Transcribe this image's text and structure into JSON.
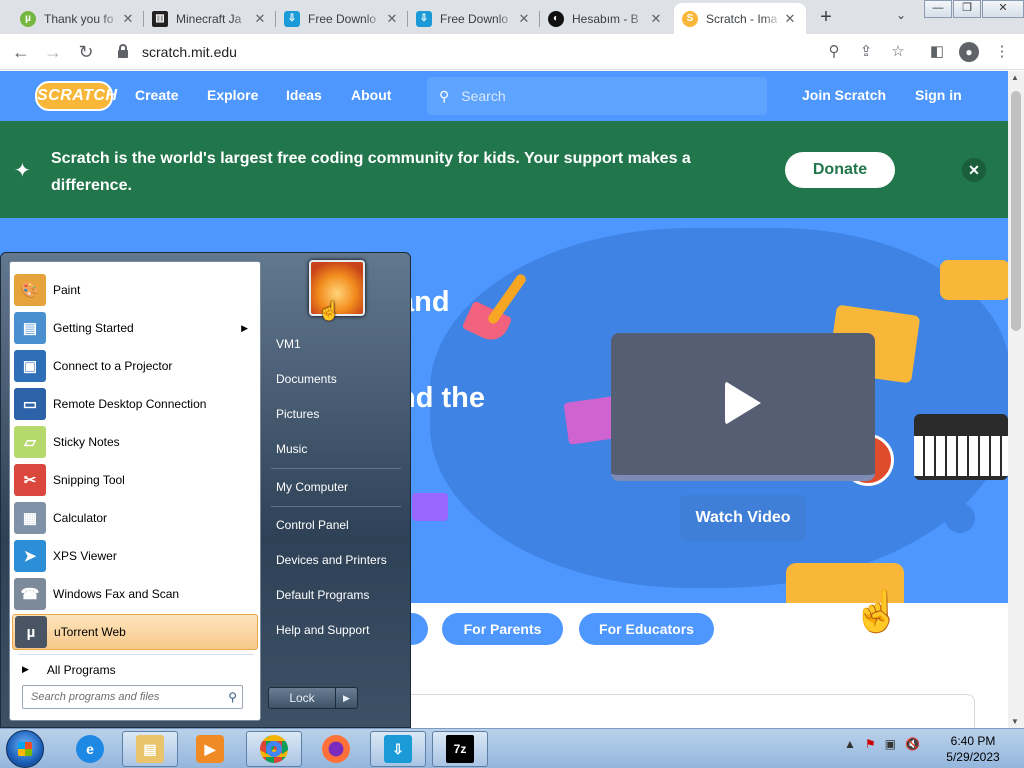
{
  "browser": {
    "tabs": [
      {
        "title": "Thank you fo",
        "favicon": "utorrent-icon",
        "color": "#76b83f"
      },
      {
        "title": "Minecraft Ja",
        "favicon": "museum-icon",
        "color": "#222222"
      },
      {
        "title": "Free Downlo",
        "favicon": "download-icon",
        "color": "#1a9bd7"
      },
      {
        "title": "Free Downlo",
        "favicon": "download-icon",
        "color": "#1a9bd7"
      },
      {
        "title": "Hesabım - B",
        "favicon": "circle-icon",
        "color": "#111111"
      },
      {
        "title": "Scratch - Ima",
        "favicon": "scratch-icon",
        "color": "#f9b739"
      }
    ],
    "new_tab": "+",
    "url": "scratch.mit.edu"
  },
  "scratch": {
    "logo": "SCRATCH",
    "nav": [
      "Create",
      "Explore",
      "Ideas",
      "About"
    ],
    "search_placeholder": "Search",
    "join": "Join Scratch",
    "signin": "Sign in",
    "banner_text": "Scratch is the world's largest free coding community for kids. Your support makes a difference.",
    "donate": "Donate",
    "hero_line1": "and",
    "hero_line2": "nd the",
    "watch_video": "Watch Video",
    "pills": [
      "For Parents",
      "For Educators"
    ]
  },
  "startmenu": {
    "programs": [
      {
        "label": "Paint",
        "icon": "paint-icon",
        "color": "#e7a33b"
      },
      {
        "label": "Getting Started",
        "icon": "getting-started-icon",
        "color": "#4a8fd0",
        "submenu": true
      },
      {
        "label": "Connect to a Projector",
        "icon": "projector-icon",
        "color": "#2f6fb7"
      },
      {
        "label": "Remote Desktop Connection",
        "icon": "remote-desktop-icon",
        "color": "#2c63a8"
      },
      {
        "label": "Sticky Notes",
        "icon": "sticky-notes-icon",
        "color": "#b6d96e"
      },
      {
        "label": "Snipping Tool",
        "icon": "scissors-icon",
        "color": "#d9473d"
      },
      {
        "label": "Calculator",
        "icon": "calculator-icon",
        "color": "#7f92a8"
      },
      {
        "label": "XPS Viewer",
        "icon": "xps-icon",
        "color": "#2b8ed6"
      },
      {
        "label": "Windows Fax and Scan",
        "icon": "fax-icon",
        "color": "#7c8a99"
      },
      {
        "label": "uTorrent Web",
        "icon": "utorrent-icon",
        "color": "#4a5563"
      }
    ],
    "all_programs": "All Programs",
    "search_placeholder": "Search programs and files",
    "right_links": [
      "VM1",
      "Documents",
      "Pictures",
      "Music",
      "My Computer",
      "Control Panel",
      "Devices and Printers",
      "Default Programs",
      "Help and Support"
    ],
    "lock": "Lock"
  },
  "taskbar": {
    "apps": [
      "internet-explorer-icon",
      "file-explorer-icon",
      "media-player-icon",
      "chrome-icon",
      "firefox-icon",
      "download-manager-icon",
      "7zip-icon"
    ],
    "time": "6:40 PM",
    "date": "5/29/2023"
  }
}
